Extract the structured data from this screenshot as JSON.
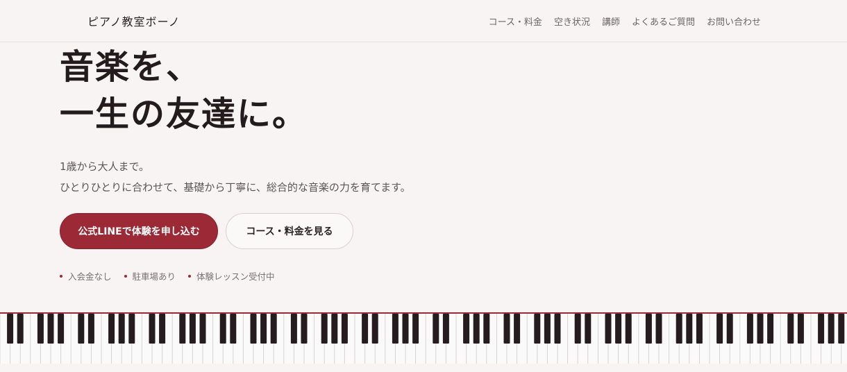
{
  "header": {
    "brand": "ピアノ教室ボーノ",
    "nav": [
      "コース・料金",
      "空き状況",
      "講師",
      "よくあるご質問",
      "お問い合わせ"
    ]
  },
  "hero": {
    "title_line1": "音楽を、",
    "title_line2": "一生の友達に。",
    "lead_line1": "1歳から大人まで。",
    "lead_line2": "ひとりひとりに合わせて、基礎から丁寧に、総合的な音楽の力を育てます。",
    "cta_primary": "公式LINEで体験を申し込む",
    "cta_secondary": "コース・料金を見る",
    "badges": [
      "入会金なし",
      "駐車場あり",
      "体験レッスン受付中"
    ]
  },
  "colors": {
    "accent": "#9b2a36",
    "background": "#f8f4f3",
    "text": "#2a2224"
  },
  "icons": {
    "badge_bullet": "dot-icon",
    "keyboard": "piano-keyboard-illustration"
  }
}
